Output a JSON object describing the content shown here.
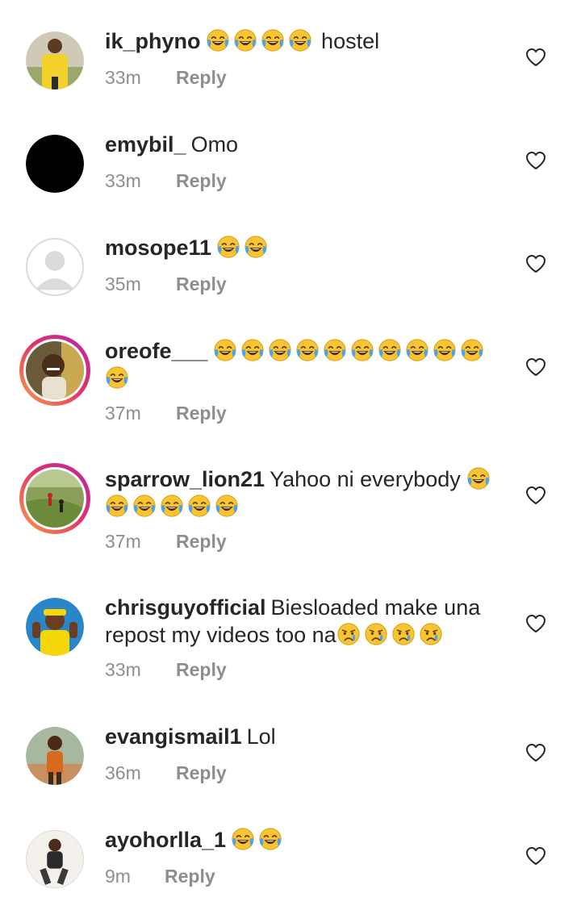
{
  "comments": [
    {
      "username": "ik_phyno",
      "emoji_before": 4,
      "text": "hostel",
      "emoji_after": 0,
      "time": "33m",
      "reply": "Reply",
      "avatar": "photo-yellow-shirt"
    },
    {
      "username": "emybil_",
      "emoji_before": 0,
      "text": "Omo",
      "emoji_after": 0,
      "time": "33m",
      "reply": "Reply",
      "avatar": "black-circle"
    },
    {
      "username": "mosope11",
      "emoji_before": 2,
      "text": "",
      "emoji_after": 0,
      "time": "35m",
      "reply": "Reply",
      "avatar": "default-placeholder"
    },
    {
      "username": "oreofe___",
      "emoji_before": 11,
      "text": "",
      "emoji_after": 0,
      "time": "37m",
      "reply": "Reply",
      "avatar": "photo-smiling-man",
      "story_ring": true
    },
    {
      "username": "sparrow_lion21",
      "emoji_before": 0,
      "text": "Yahoo ni everybody",
      "emoji_after": 6,
      "time": "37m",
      "reply": "Reply",
      "avatar": "photo-field",
      "story_ring": true
    },
    {
      "username": "chrisguyofficial",
      "emoji_before": 0,
      "text": "Biesloaded make una repost my videos too na",
      "emoji_after": 4,
      "emoji_type": "crying",
      "time": "33m",
      "reply": "Reply",
      "avatar": "photo-yellow-cap"
    },
    {
      "username": "evangismail1",
      "emoji_before": 0,
      "text": "Lol",
      "emoji_after": 0,
      "time": "36m",
      "reply": "Reply",
      "avatar": "photo-outdoor-man"
    },
    {
      "username": "ayohorlla_1",
      "emoji_before": 2,
      "text": "",
      "emoji_after": 0,
      "time": "9m",
      "reply": "Reply",
      "avatar": "photo-dancer"
    }
  ],
  "icons": {
    "like": "heart-outline-icon",
    "laugh_emoji": "face-with-tears-of-joy",
    "cry_emoji": "crying-face"
  },
  "colors": {
    "text_primary": "#262626",
    "text_secondary": "#8e8e8e",
    "story_ring_start": "#f9a03f",
    "story_ring_end": "#b52aa6",
    "emoji_face": "#f7c531"
  }
}
